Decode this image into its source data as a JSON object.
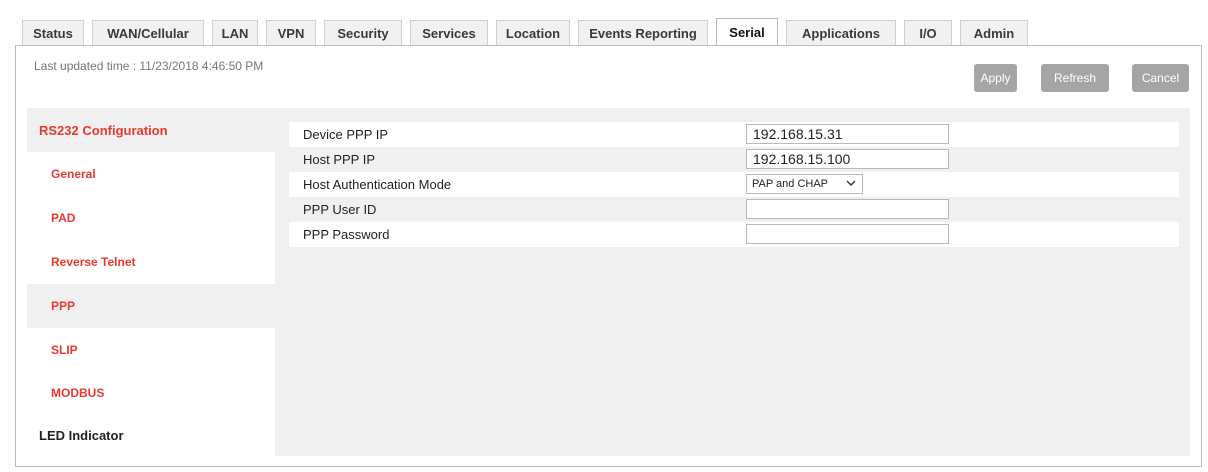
{
  "tabs": [
    {
      "label": "Status",
      "active": false
    },
    {
      "label": "WAN/Cellular",
      "active": false
    },
    {
      "label": "LAN",
      "active": false
    },
    {
      "label": "VPN",
      "active": false
    },
    {
      "label": "Security",
      "active": false
    },
    {
      "label": "Services",
      "active": false
    },
    {
      "label": "Location",
      "active": false
    },
    {
      "label": "Events Reporting",
      "active": false
    },
    {
      "label": "Serial",
      "active": true
    },
    {
      "label": "Applications",
      "active": false
    },
    {
      "label": "I/O",
      "active": false
    },
    {
      "label": "Admin",
      "active": false
    }
  ],
  "header": {
    "last_updated": "Last updated time : 11/23/2018 4:46:50 PM",
    "apply_label": "Apply",
    "refresh_label": "Refresh",
    "cancel_label": "Cancel"
  },
  "sidebar": {
    "items": [
      {
        "label": "RS232 Configuration"
      },
      {
        "label": "General"
      },
      {
        "label": "PAD"
      },
      {
        "label": "Reverse Telnet"
      },
      {
        "label": "PPP"
      },
      {
        "label": "SLIP"
      },
      {
        "label": "MODBUS"
      },
      {
        "label": "LED Indicator"
      }
    ]
  },
  "form": {
    "device_ppp_ip": {
      "label": "Device PPP IP",
      "value": "192.168.15.31"
    },
    "host_ppp_ip": {
      "label": "Host PPP IP",
      "value": "192.168.15.100"
    },
    "host_auth_mode": {
      "label": "Host Authentication Mode",
      "value": "PAP and CHAP"
    },
    "ppp_user_id": {
      "label": "PPP User ID",
      "value": ""
    },
    "ppp_password": {
      "label": "PPP Password",
      "value": ""
    }
  },
  "colors": {
    "accent_red": "#e8392f",
    "button_gray": "#a5a5a5",
    "panel_gray": "#f0f0f0"
  },
  "icons": {
    "dropdown": "chevron-down-icon"
  }
}
